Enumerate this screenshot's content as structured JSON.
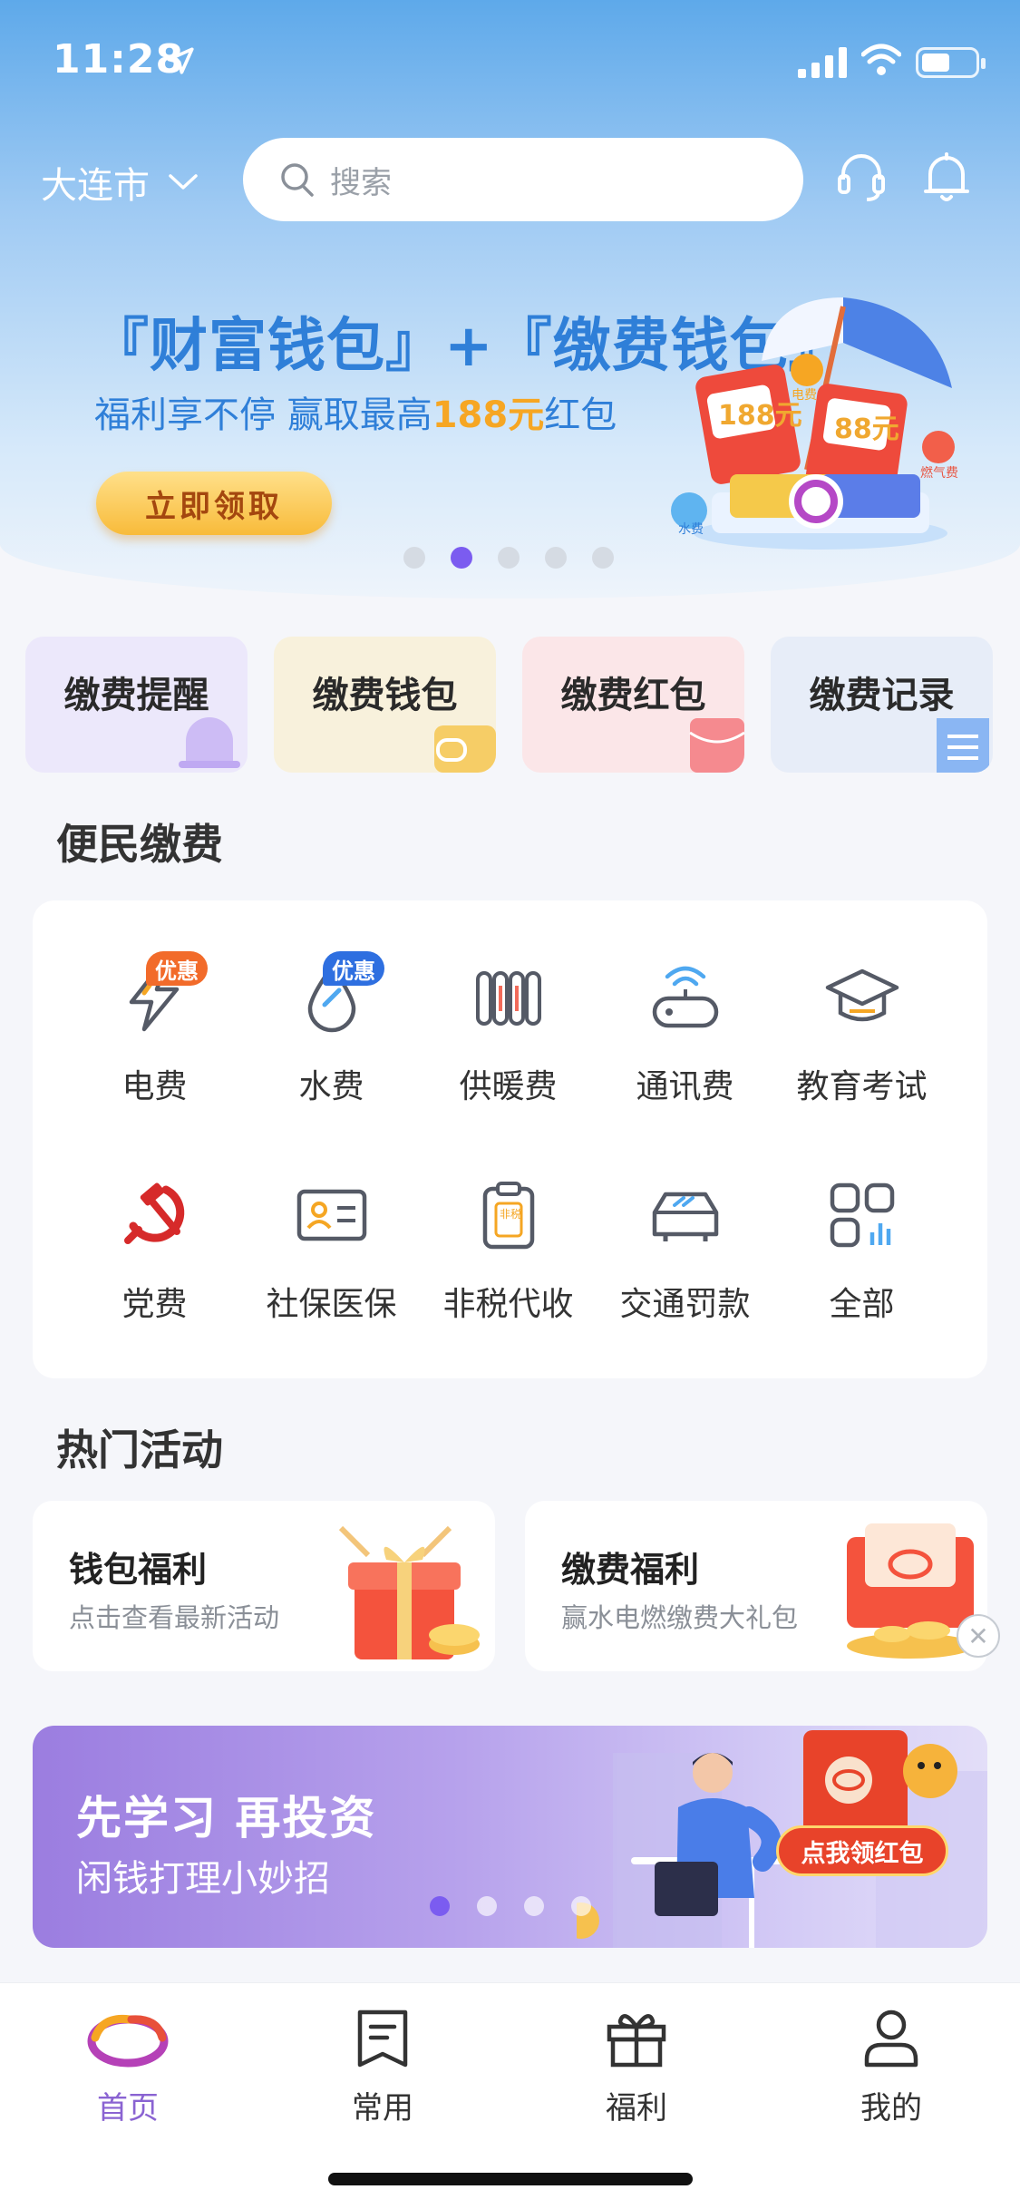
{
  "status_bar": {
    "time": "11:28"
  },
  "header": {
    "city": "大连市",
    "search_placeholder": "搜索"
  },
  "banner": {
    "title": "『财富钱包』+『缴费钱包』",
    "subtitle_prefix": "福利享不停 赢取最高",
    "subtitle_highlight": "188元",
    "subtitle_suffix": "红包",
    "button": "立即领取",
    "slide_count": 5,
    "active_slide": 2,
    "art": {
      "coupon1": "188元",
      "coupon2": "88元",
      "tag_water": "水费",
      "tag_elec": "电费",
      "tag_gas": "燃气费"
    }
  },
  "quick_cards": [
    {
      "label": "缴费提醒",
      "bg": "#ece8fb",
      "accent": "#c9b8f4"
    },
    {
      "label": "缴费钱包",
      "bg": "#f8f1dc",
      "accent": "#f6cd66"
    },
    {
      "label": "缴费红包",
      "bg": "#fbe6e8",
      "accent": "#f58a8f"
    },
    {
      "label": "缴费记录",
      "bg": "#e7edf8",
      "accent": "#8ab6f3"
    }
  ],
  "services": {
    "title": "便民缴费",
    "items": [
      {
        "label": "电费",
        "badge": "优惠",
        "badge_color": "#f26b2a"
      },
      {
        "label": "水费",
        "badge": "优惠",
        "badge_color": "#2e6fe0"
      },
      {
        "label": "供暖费"
      },
      {
        "label": "通讯费"
      },
      {
        "label": "教育考试"
      },
      {
        "label": "党费"
      },
      {
        "label": "社保医保"
      },
      {
        "label": "非税代收",
        "icon_text": "非税"
      },
      {
        "label": "交通罚款"
      },
      {
        "label": "全部"
      }
    ]
  },
  "activities": {
    "title": "热门活动",
    "items": [
      {
        "title": "钱包福利",
        "subtitle": "点击查看最新活动"
      },
      {
        "title": "缴费福利",
        "subtitle": "赢水电燃缴费大礼包"
      }
    ]
  },
  "promo": {
    "title": "先学习 再投资",
    "subtitle": "闲钱打理小妙招",
    "cta": "点我领红包",
    "slide_count": 4,
    "active_slide": 1
  },
  "tabbar": {
    "items": [
      {
        "label": "首页",
        "active": true
      },
      {
        "label": "常用"
      },
      {
        "label": "福利"
      },
      {
        "label": "我的"
      }
    ]
  },
  "colors": {
    "accent": "#7b5cf0",
    "brand_blue": "#2f7fd8",
    "active_tab": "#8a63d2"
  }
}
